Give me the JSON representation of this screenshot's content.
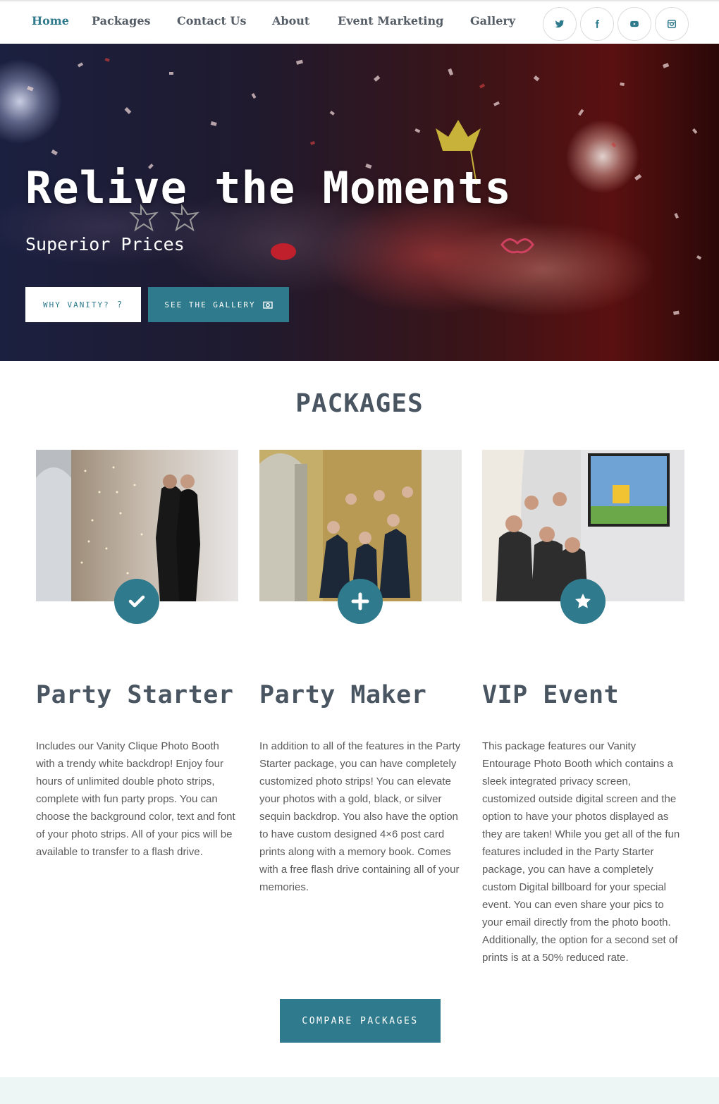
{
  "nav": {
    "items": [
      {
        "label": "Home",
        "active": true
      },
      {
        "label": "Packages"
      },
      {
        "label": "Contact Us"
      },
      {
        "label": "About"
      },
      {
        "label": "Event Marketing"
      },
      {
        "label": "Gallery"
      }
    ],
    "social": [
      "twitter-icon",
      "facebook-icon",
      "youtube-icon",
      "instagram-icon"
    ]
  },
  "hero": {
    "title": "Relive the Moments",
    "subtitle": "Superior Prices",
    "btn_why": "WHY VANITY?",
    "btn_gallery": "SEE THE GALLERY"
  },
  "packages": {
    "heading": "PACKAGES",
    "cards": [
      {
        "title": "Party Starter",
        "icon": "check-icon",
        "text": "Includes our Vanity Clique Photo Booth with a trendy white backdrop! Enjoy four hours of unlimited double photo strips, complete with fun party props. You can choose the background color, text and font of your photo strips. All of your pics will be available to transfer to a flash drive."
      },
      {
        "title": "Party Maker",
        "icon": "plus-icon",
        "text": "In addition to all of the features in the Party Starter package, you can have completely customized photo strips! You can elevate your photos with a gold, black, or silver sequin backdrop. You also have the option to have custom designed 4×6 post card prints along with a memory book. Comes with a free flash drive containing all of your memories."
      },
      {
        "title": "VIP Event",
        "icon": "star-icon",
        "text": "This package features our Vanity Entourage Photo Booth which contains a sleek integrated privacy screen, customized outside digital screen and the option to have your photos displayed as they are taken! While you get all of the fun features included in the Party Starter package, you can have a completely custom Digital billboard for your special event. You can even share your pics to your email directly from the photo booth. Additionally, the option for a second set of prints is at a 50% reduced rate."
      }
    ],
    "compare_label": "COMPARE PACKAGES"
  },
  "colors": {
    "accent": "#2f7a8c",
    "heading": "#4a5562"
  }
}
